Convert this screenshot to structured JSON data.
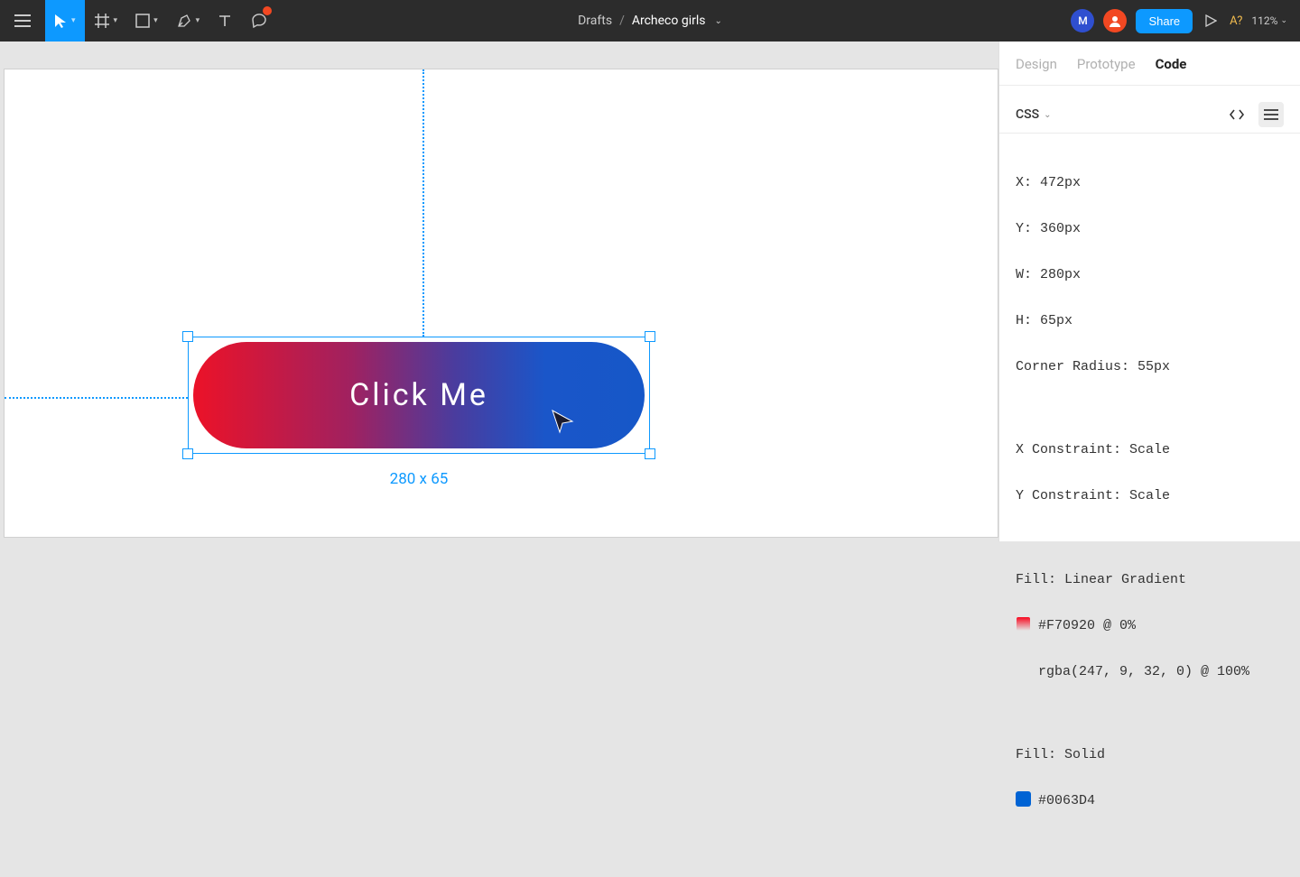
{
  "toolbar": {
    "breadcrumb_folder": "Drafts",
    "breadcrumb_doc": "Archeco girls",
    "share_label": "Share",
    "help_label": "A?",
    "zoom_label": "112%",
    "avatar_initial": "M"
  },
  "canvas": {
    "button_text": "Click Me",
    "dimensions_label": "280 x 65"
  },
  "inspector": {
    "tabs": {
      "design": "Design",
      "prototype": "Prototype",
      "code": "Code"
    },
    "lang": "CSS",
    "lines": {
      "x": "X: 472px",
      "y": "Y: 360px",
      "w": "W: 280px",
      "h": "H: 65px",
      "corner": "Corner Radius: 55px",
      "xcon": "X Constraint: Scale",
      "ycon": "Y Constraint: Scale",
      "fill1": "Fill: Linear Gradient",
      "stop1": "#F70920 @ 0%",
      "stop2": "rgba(247, 9, 32, 0) @ 100%",
      "fill2": "Fill: Solid",
      "solid": "#0063D4"
    }
  }
}
